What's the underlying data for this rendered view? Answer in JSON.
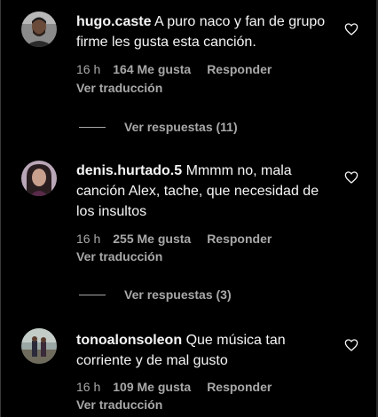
{
  "comments": [
    {
      "username": "hugo.caste",
      "text": "A puro naco y fan de grupo firme les gusta esta canción.",
      "time": "16 h",
      "likes": "164 Me gusta",
      "reply_label": "Responder",
      "translate_label": "Ver traducción",
      "view_replies": "Ver respuestas (11)",
      "avatar_icon": "user-avatar-man"
    },
    {
      "username": "denis.hurtado.5",
      "text": "Mmmm no, mala canción Alex, tache, que necesidad de los insultos",
      "time": "16 h",
      "likes": "255 Me gusta",
      "reply_label": "Responder",
      "translate_label": "Ver traducción",
      "view_replies": "Ver respuestas (3)",
      "avatar_icon": "user-avatar-woman"
    },
    {
      "username": "tonoalonsoleon",
      "text": "Que música tan corriente y de mal gusto",
      "time": "16 h",
      "likes": "109 Me gusta",
      "reply_label": "Responder",
      "translate_label": "Ver traducción",
      "avatar_icon": "user-avatar-outdoor"
    }
  ],
  "icons": {
    "like": "heart-outline-icon"
  },
  "colors": {
    "background": "#000000",
    "primary_text": "#f5f5f5",
    "secondary_text": "#a8a8a8"
  }
}
